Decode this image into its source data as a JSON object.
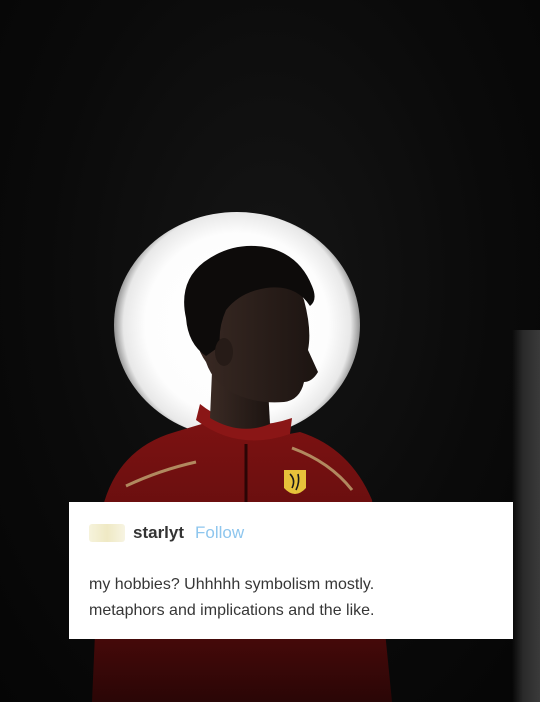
{
  "post": {
    "username": "starlyt",
    "follow_label": "Follow",
    "body_line1": "my hobbies? Uhhhhh symbolism mostly.",
    "body_line2": "metaphors and implications and the like."
  },
  "colors": {
    "follow_link": "#8ec6ee",
    "racing_suit": "#8a1414",
    "background": "#0b0b0b"
  }
}
